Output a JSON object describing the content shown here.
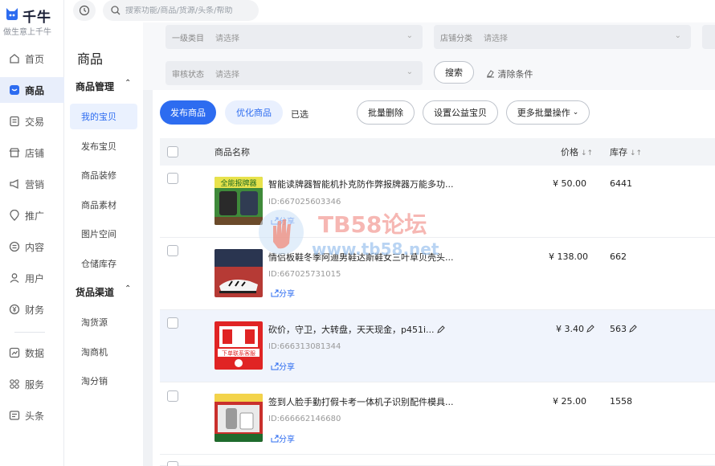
{
  "brand": {
    "name": "千牛",
    "slogan": "做生意上千牛"
  },
  "nav": [
    {
      "label": "首页",
      "icon": "home-icon"
    },
    {
      "label": "商品",
      "icon": "goods-icon",
      "active": true
    },
    {
      "label": "交易",
      "icon": "trade-icon"
    },
    {
      "label": "店铺",
      "icon": "shop-icon"
    },
    {
      "label": "营销",
      "icon": "megaphone-icon"
    },
    {
      "label": "推广",
      "icon": "location-pin-icon"
    },
    {
      "label": "内容",
      "icon": "content-icon"
    },
    {
      "label": "用户",
      "icon": "user-icon"
    },
    {
      "label": "财务",
      "icon": "yen-icon"
    },
    {
      "label": "数据",
      "icon": "chart-icon"
    },
    {
      "label": "服务",
      "icon": "grid-icon"
    },
    {
      "label": "头条",
      "icon": "news-icon"
    }
  ],
  "search": {
    "placeholder": "搜索功能/商品/货源/头条/帮助"
  },
  "sidebar": {
    "title": "商品",
    "groups": [
      {
        "label": "商品管理",
        "items": [
          "我的宝贝",
          "发布宝贝",
          "商品装修",
          "商品素材",
          "图片空间",
          "仓储库存"
        ]
      },
      {
        "label": "货品渠道",
        "items": [
          "淘货源",
          "淘商机",
          "淘分销"
        ]
      }
    ]
  },
  "filters": {
    "category": {
      "label": "一级类目",
      "value": "请选择"
    },
    "shop_category": {
      "label": "店铺分类",
      "value": "请选择"
    },
    "review_status": {
      "label": "审核状态",
      "value": "请选择"
    },
    "search_button": "搜索",
    "clear_button": "清除条件"
  },
  "toolbar": {
    "publish": "发布商品",
    "optimize": "优化商品",
    "selected": "已选",
    "batch_delete": "批量删除",
    "set_charity": "设置公益宝贝",
    "more_batch": "更多批量操作"
  },
  "table": {
    "headers": {
      "name": "商品名称",
      "price": "价格",
      "stock": "库存"
    },
    "share_label": "分享",
    "rows": [
      {
        "name": "智能读牌器智能机扑克防作弊报牌器万能多功...",
        "id": "ID:667025603346",
        "price": "¥ 50.00",
        "stock": "6441",
        "thumb_text": "全能报牌器"
      },
      {
        "name": "情侣板鞋冬季阿迪男鞋达斯鞋女三叶草贝壳头...",
        "id": "ID:667025731015",
        "price": "¥ 138.00",
        "stock": "662",
        "thumb_text": ""
      },
      {
        "name": "砍价，守卫，大转盘，天天现金，p451i...",
        "id": "ID:666313081344",
        "price": "¥ 3.40",
        "stock": "563",
        "thumb_text": "下单联系客服"
      },
      {
        "name": "签到人脸手勤打假卡考一体机子识别配件模具...",
        "id": "ID:666662146680",
        "price": "¥ 25.00",
        "stock": "1558",
        "thumb_text": ""
      }
    ]
  },
  "watermark": {
    "title": "TB58论坛",
    "url": "www.tb58.net"
  },
  "colors": {
    "accent": "#2d6cf0",
    "rail_active": "#e8eefb",
    "row_highlight": "#f0f4fc"
  }
}
